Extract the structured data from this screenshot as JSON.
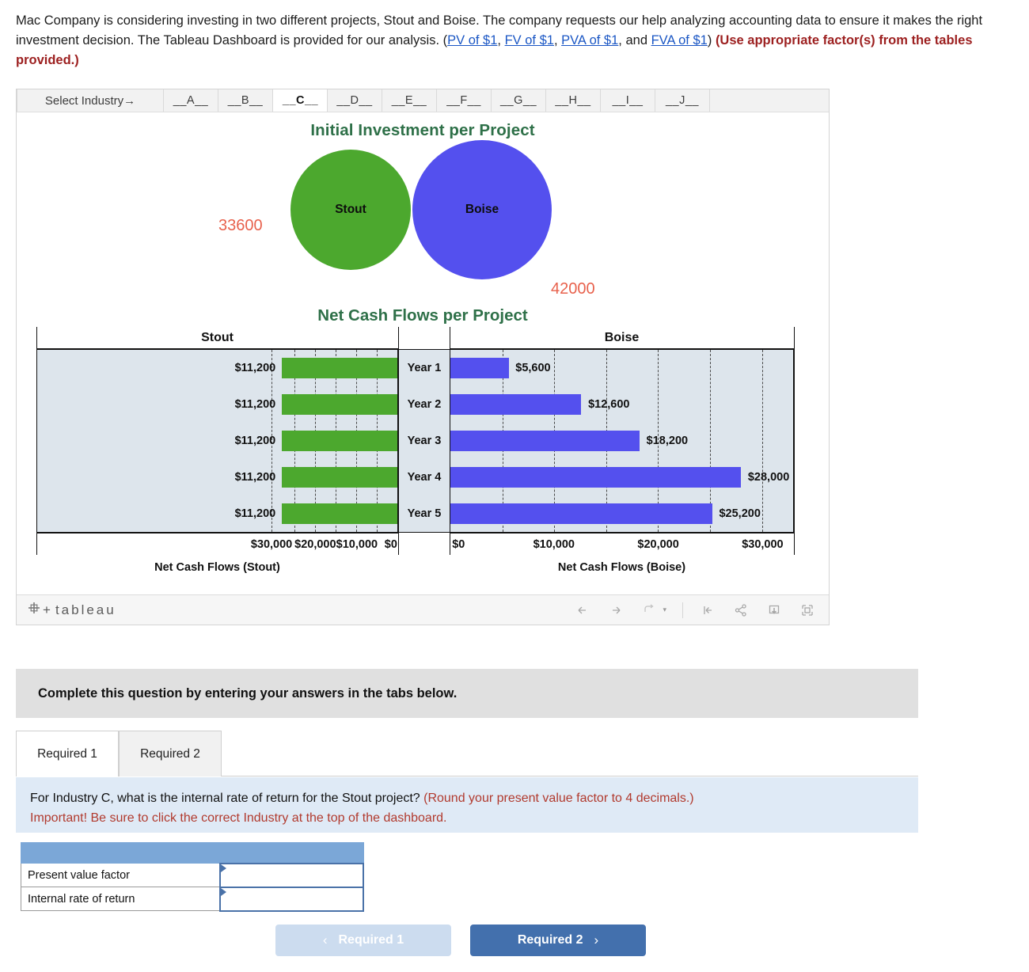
{
  "intro": {
    "part1": "Mac Company is considering investing in two different projects, Stout and Boise. The company requests our help analyzing accounting data to ensure it makes the right investment decision. The Tableau Dashboard is provided for our analysis. (",
    "link_pv": "PV of $1",
    "sep1": ", ",
    "link_fv": "FV of $1",
    "sep2": ", ",
    "link_pva": "PVA of $1",
    "sep3": ", and ",
    "link_fva": "FVA of $1",
    "sep4": ") ",
    "note": "(Use appropriate factor(s) from the tables provided.)"
  },
  "dashboard": {
    "industry_label": "Select Industry→",
    "industries": [
      {
        "label": "__A__",
        "active": false
      },
      {
        "label": "__B__",
        "active": false
      },
      {
        "label": "__C__",
        "active": true
      },
      {
        "label": "__D__",
        "active": false
      },
      {
        "label": "__E__",
        "active": false
      },
      {
        "label": "__F__",
        "active": false
      },
      {
        "label": "__G__",
        "active": false
      },
      {
        "label": "__H__",
        "active": false
      },
      {
        "label": "__I__",
        "active": false
      },
      {
        "label": "__J__",
        "active": false
      }
    ],
    "tableau_logo": "tableau",
    "toolbar": {
      "back": "back-arrow",
      "forward": "forward-arrow",
      "revert": "revert",
      "revert_caret": "▾",
      "reset": "reset",
      "share": "share",
      "download": "download",
      "fullscreen": "fullscreen"
    }
  },
  "chart_data": [
    {
      "type": "bar",
      "title": "Initial Investment per Project",
      "categories": [
        "Stout",
        "Boise"
      ],
      "values": [
        33600,
        42000
      ],
      "labels": [
        "33600",
        "42000"
      ],
      "colors": [
        "#4CA82E",
        "#5450EE"
      ],
      "title_color": "#2E7048",
      "label_color": "#E8614C",
      "xlabel": "",
      "ylabel": "",
      "legend": "none"
    },
    {
      "type": "bar",
      "title": "Net Cash Flows per Project",
      "orientation": "horizontal-diverging",
      "categories": [
        "Year 1",
        "Year 2",
        "Year 3",
        "Year 4",
        "Year 5"
      ],
      "series": [
        {
          "name": "Stout",
          "values": [
            11200,
            11200,
            11200,
            11200,
            11200
          ],
          "labels": [
            "$11,200",
            "$11,200",
            "$11,200",
            "$11,200",
            "$11,200"
          ],
          "color": "#4CA82E",
          "axis_title": "Net Cash Flows (Stout)",
          "ticks": [
            "$30,000",
            "$20,000",
            "$10,000",
            "$0"
          ],
          "tick_values": [
            30000,
            20000,
            10000,
            0
          ],
          "xlim": [
            0,
            35000
          ],
          "direction": "right-to-left"
        },
        {
          "name": "Boise",
          "values": [
            5600,
            12600,
            18200,
            28000,
            25200
          ],
          "labels": [
            "$5,600",
            "$12,600",
            "$18,200",
            "$28,000",
            "$25,200"
          ],
          "color": "#5450EE",
          "axis_title": "Net Cash Flows (Boise)",
          "ticks": [
            "$0",
            "$10,000",
            "$20,000",
            "$30,000"
          ],
          "tick_values": [
            0,
            10000,
            20000,
            30000
          ],
          "xlim": [
            0,
            33000
          ],
          "direction": "left-to-right"
        }
      ],
      "grid": true,
      "grid_interval": 5000,
      "plot_background": "#DDE5EC",
      "title_color": "#2E7048",
      "legend": "none"
    }
  ],
  "question": {
    "banner": "Complete this question by entering your answers in the tabs below.",
    "tabs": [
      {
        "label": "Required 1",
        "active": true
      },
      {
        "label": "Required 2",
        "active": false
      }
    ],
    "prompt_black": "For Industry C, what is the internal rate of return for the Stout project? ",
    "prompt_red": "(Round your present value factor to 4 decimals.)",
    "prompt_red2": "Important! Be sure to click the correct Industry at the top of the dashboard."
  },
  "answer_table": {
    "header": "",
    "rows": [
      {
        "label": "Present value factor",
        "value": "",
        "placeholder": ""
      },
      {
        "label": "Internal rate of return",
        "value": "",
        "placeholder": ""
      }
    ]
  },
  "nav": {
    "prev_chev": "‹",
    "prev_label": "Required 1",
    "next_label": "Required 2",
    "next_chev": "›"
  }
}
